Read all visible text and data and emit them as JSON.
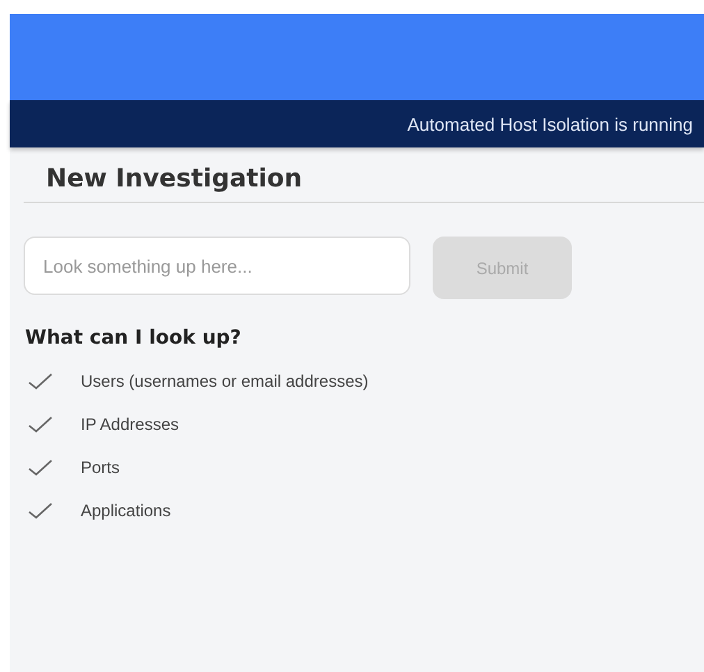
{
  "banner": {
    "text": "Automated Host Isolation is running"
  },
  "page": {
    "title": "New Investigation"
  },
  "search": {
    "placeholder": "Look something up here...",
    "submit": {
      "label": "Submit",
      "disabled": true
    }
  },
  "help": {
    "heading": "What can I look up?",
    "items": [
      {
        "label": "Users (usernames or email addresses)"
      },
      {
        "label": "IP Addresses"
      },
      {
        "label": "Ports"
      },
      {
        "label": "Applications"
      }
    ]
  }
}
